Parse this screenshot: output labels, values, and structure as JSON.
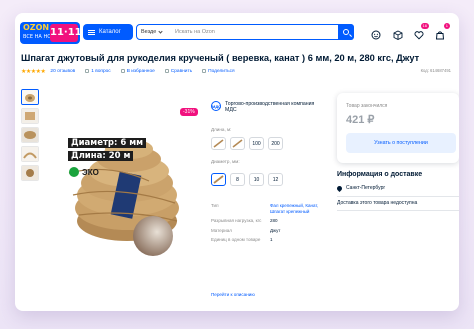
{
  "header": {
    "logo_text": "OZON",
    "logo_sub": "ВСЕ НА НОВОЙ",
    "logo_event": "11·11",
    "catalog_label": "Каталог",
    "search_category": "Везде",
    "search_placeholder": "Искать на Ozon",
    "badges": {
      "orders": "",
      "favorites": "16",
      "cart": "1"
    }
  },
  "product": {
    "title": "Шпагат джутовый для рукоделия крученый ( веревка, канат ) 6 мм, 20 м, 280 кгс, Джут",
    "rating_stars": "★★★★★",
    "reviews": "20 отзывов",
    "questions": "1 вопрос",
    "favorites": "В избранное",
    "compare": "Сравнить",
    "share": "Поделиться",
    "code": "Код: 614687491",
    "discount": "-31%",
    "image_text_1": "Диаметр: 6 мм",
    "image_text_2": "Длина: 20 м",
    "image_eco": "ЭКО"
  },
  "seller": {
    "logo": "МДС",
    "name": "Торгово-производственная компания МДС"
  },
  "options": {
    "length_label": "Длина, м:",
    "length_values": [
      "",
      "",
      "100",
      "200"
    ],
    "diameter_label": "Диаметр, мм:",
    "diameter_values": [
      "",
      "8",
      "10",
      "12"
    ]
  },
  "specs": [
    {
      "k": "Тип",
      "v": "Фал крепежный, Канат, Шпагат крепежный",
      "link": true
    },
    {
      "k": "Разрывная нагрузка, кгс",
      "v": "280",
      "link": false
    },
    {
      "k": "Материал",
      "v": "Джут",
      "link": false
    },
    {
      "k": "Единиц в одном товаре",
      "v": "1",
      "link": false
    }
  ],
  "desc_link": "Перейти к описанию",
  "price_box": {
    "label": "Товар закончился",
    "price": "421 ₽",
    "button": "Узнать о поступлении"
  },
  "delivery": {
    "title": "Информация о доставке",
    "city": "Санкт-Петербург",
    "note": "Доставка этого товара недоступна"
  },
  "colors": {
    "brand": "#005bff",
    "accent": "#f1117e",
    "star": "#ffa800"
  }
}
